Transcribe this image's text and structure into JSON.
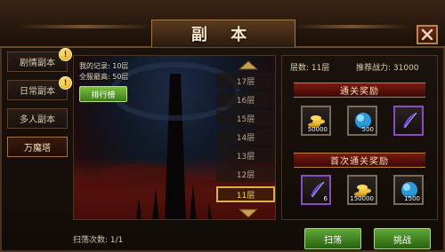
{
  "title": "副 本",
  "tabs": [
    {
      "label": "剧情副本",
      "badge": "!"
    },
    {
      "label": "日常副本",
      "badge": "!"
    },
    {
      "label": "多人副本",
      "badge": ""
    },
    {
      "label": "万魔塔",
      "badge": ""
    }
  ],
  "record": {
    "my_record": "我的记录: 10层",
    "server_best": "全服最高: 50层",
    "rank_button": "排行榜"
  },
  "floors": [
    "17层",
    "16层",
    "15层",
    "14层",
    "13层",
    "12层",
    "11层"
  ],
  "selected_floor": "11层",
  "stats": {
    "floor_label": "层数: 11层",
    "power_label": "推荐战力: 31000"
  },
  "clear_reward": {
    "title": "通关奖励",
    "items": [
      {
        "icon": "gold-coins-icon",
        "count": "50000"
      },
      {
        "icon": "blue-orb-icon",
        "count": "500"
      },
      {
        "icon": "purple-feather-icon",
        "count": ""
      }
    ]
  },
  "first_reward": {
    "title": "首次通关奖励",
    "items": [
      {
        "icon": "purple-feather-icon",
        "count": "6"
      },
      {
        "icon": "gold-coins-icon",
        "count": "150000"
      },
      {
        "icon": "blue-orb-icon",
        "count": "1500"
      }
    ]
  },
  "sweep_count": "扫荡次数: 1/1",
  "buttons": {
    "sweep": "扫荡",
    "challenge": "挑战"
  }
}
